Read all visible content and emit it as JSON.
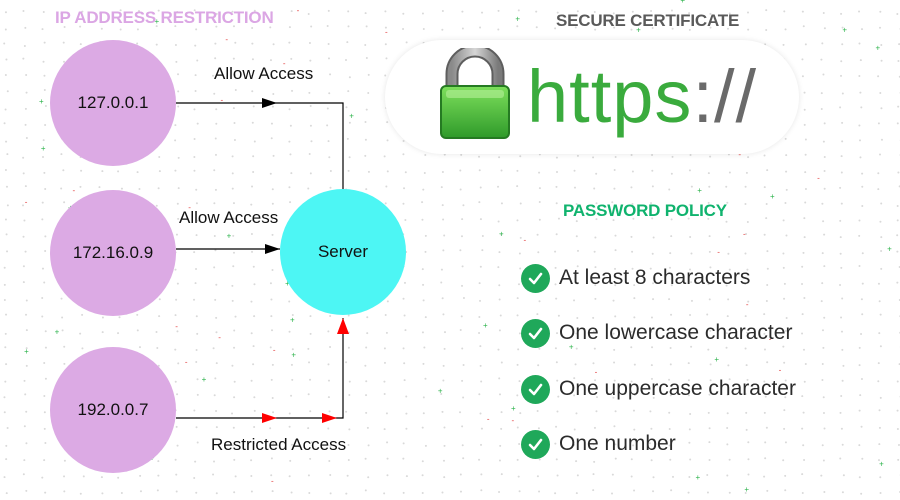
{
  "colors": {
    "ip_node": "#dcaae4",
    "server_node": "#4df6f4",
    "ip_title": "#dba6e4",
    "policy_title": "#10b36e",
    "allow_arrow": "#000000",
    "restricted_arrow": "#ff0000",
    "check": "#1fa85a"
  },
  "ip_restriction": {
    "title": "IP ADDRESS RESTRICTION",
    "server_label": "Server",
    "clients": [
      {
        "ip": "127.0.0.1",
        "access": "Allow Access",
        "allowed": true
      },
      {
        "ip": "172.16.0.9",
        "access": "Allow Access",
        "allowed": true
      },
      {
        "ip": "192.0.0.7",
        "access": "Restricted Access",
        "allowed": false
      }
    ]
  },
  "certificate": {
    "title": "SECURE CERTIFICATE",
    "protocol": "https",
    "separator": "://",
    "icon": "padlock-icon"
  },
  "password_policy": {
    "title": "PASSWORD POLICY",
    "icon": "check-circle-icon",
    "rules": [
      "At least 8 characters",
      "One lowercase character",
      "One uppercase character",
      "One number"
    ]
  }
}
